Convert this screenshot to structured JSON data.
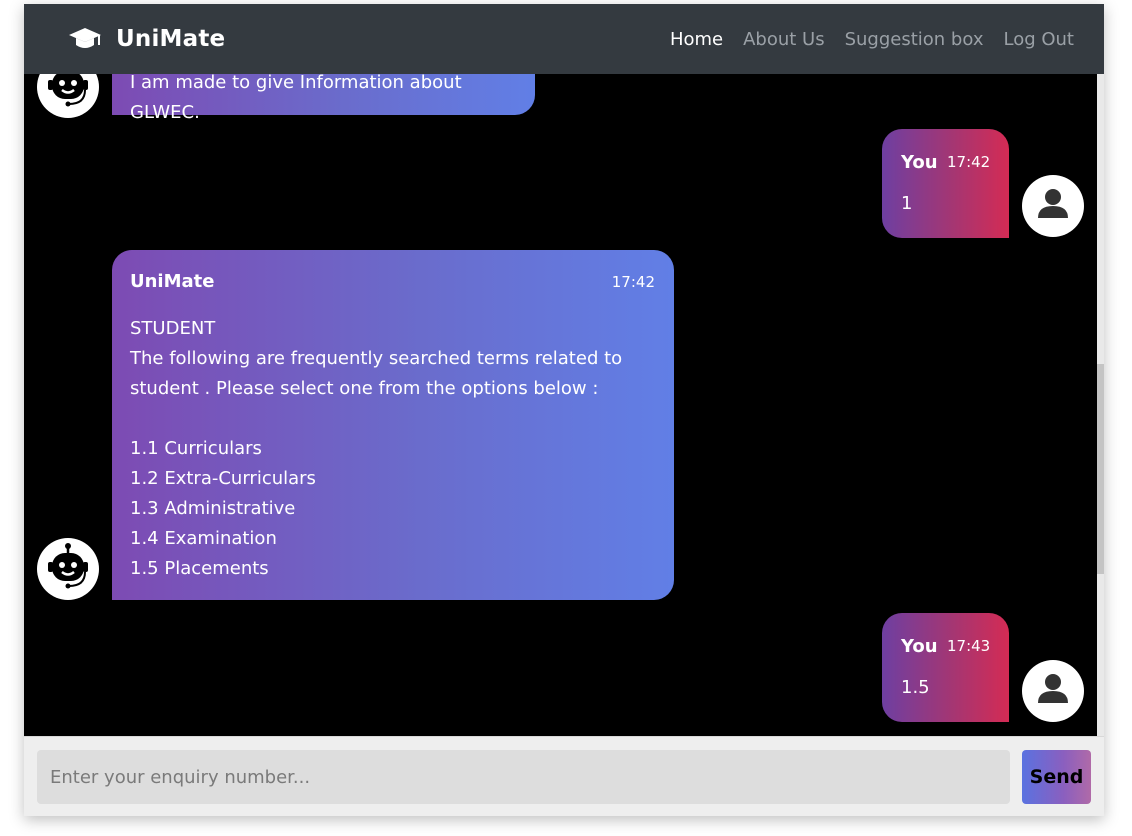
{
  "nav": {
    "brand": "UniMate",
    "brand_icon": "graduation-cap-icon",
    "links": [
      "Home",
      "About Us",
      "Suggestion box",
      "Log Out"
    ],
    "active": "Home"
  },
  "messages": [
    {
      "sender": "bot",
      "name": "",
      "time": "",
      "text": "I am made to give Information about GLWEC.",
      "avatar_icon": "robot-icon"
    },
    {
      "sender": "user",
      "name": "You",
      "time": "17:42",
      "text": "1",
      "avatar_icon": "user-icon"
    },
    {
      "sender": "bot",
      "name": "UniMate",
      "time": "17:42",
      "text": "STUDENT\nThe following are frequently searched terms related to student . Please select one from the options below :\n\n1.1 Curriculars\n1.2 Extra-Curriculars\n1.3 Administrative\n1.4 Examination\n1.5 Placements",
      "avatar_icon": "robot-icon"
    },
    {
      "sender": "user",
      "name": "You",
      "time": "17:43",
      "text": "1.5",
      "avatar_icon": "user-icon"
    }
  ],
  "input": {
    "placeholder": "Enter your enquiry number...",
    "value": ""
  },
  "send_label": "Send",
  "colors": {
    "navbar": "#343a40",
    "chat_background": "#000000",
    "bot_bubble_start": "#7d4bb3",
    "bot_bubble_end": "#617fe6",
    "user_bubble_start": "#6e3fa1",
    "user_bubble_end": "#d42b54"
  }
}
